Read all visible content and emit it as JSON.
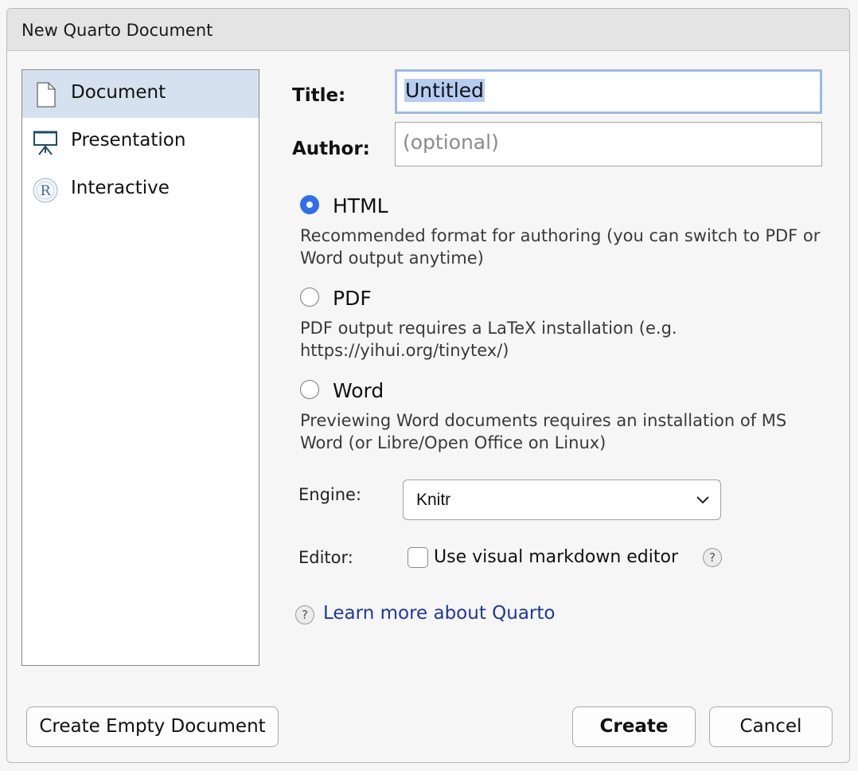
{
  "window": {
    "title": "New Quarto Document"
  },
  "sidebar": {
    "items": [
      {
        "label": "Document",
        "icon": "document-icon",
        "selected": true
      },
      {
        "label": "Presentation",
        "icon": "presentation-icon",
        "selected": false
      },
      {
        "label": "Interactive",
        "icon": "r-logo-icon",
        "selected": false
      }
    ]
  },
  "form": {
    "title_label": "Title:",
    "title_value": "Untitled",
    "author_label": "Author:",
    "author_placeholder": "(optional)",
    "formats": [
      {
        "label": "HTML",
        "selected": true,
        "description": "Recommended format for authoring (you can switch to PDF or Word output anytime)"
      },
      {
        "label": "PDF",
        "selected": false,
        "description": "PDF output requires a LaTeX installation (e.g. https://yihui.org/tinytex/)"
      },
      {
        "label": "Word",
        "selected": false,
        "description": "Previewing Word documents requires an installation of MS Word (or Libre/Open Office on Linux)"
      }
    ],
    "engine_label": "Engine:",
    "engine_value": "Knitr",
    "editor_label": "Editor:",
    "visual_editor_label": "Use visual markdown editor",
    "visual_editor_checked": false,
    "learn_more_label": "Learn more about Quarto"
  },
  "buttons": {
    "create_empty": "Create Empty Document",
    "create": "Create",
    "cancel": "Cancel"
  },
  "colors": {
    "accent": "#2f6fef",
    "selection": "#d6e1ef",
    "link": "#1d3a9b"
  }
}
